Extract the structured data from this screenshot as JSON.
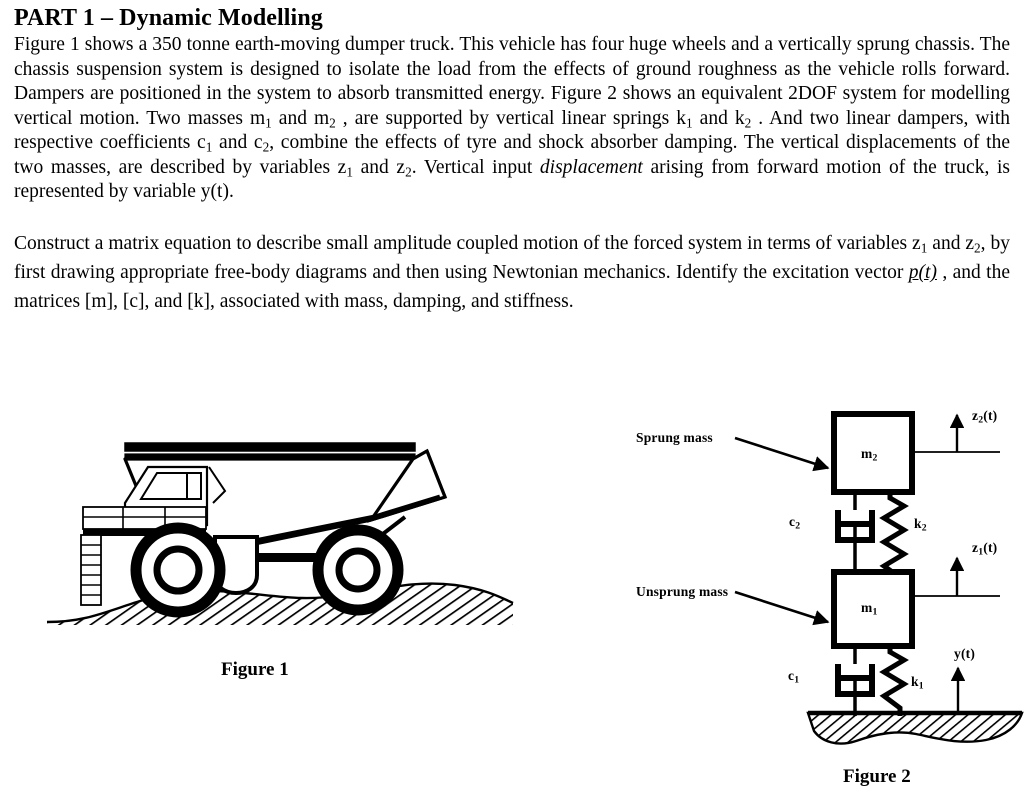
{
  "document": {
    "heading": "PART 1 –  Dynamic Modelling",
    "paragraph1": {
      "segments": [
        {
          "text": "Figure 1 shows a 350 tonne earth-moving dumper truck. This vehicle has four huge wheels and a vertically sprung chassis. The chassis suspension system is designed to isolate the load from the effects of ground roughness as the vehicle rolls forward. Dampers are positioned in the system to absorb transmitted energy. Figure 2 shows an equivalent  2DOF system for modelling vertical motion. Two masses m",
          "style": "normal"
        },
        {
          "text": "1",
          "style": "sub"
        },
        {
          "text": " and m",
          "style": "normal"
        },
        {
          "text": "2",
          "style": "sub"
        },
        {
          "text": " , are supported by vertical linear springs k",
          "style": "normal"
        },
        {
          "text": "1",
          "style": "sub"
        },
        {
          "text": " and k",
          "style": "normal"
        },
        {
          "text": "2",
          "style": "sub"
        },
        {
          "text": " . And two linear dampers, with respective coefficients c",
          "style": "normal"
        },
        {
          "text": "1",
          "style": "sub"
        },
        {
          "text": " and c",
          "style": "normal"
        },
        {
          "text": "2",
          "style": "sub"
        },
        {
          "text": ", combine the effects of tyre and shock absorber damping.  The vertical displacements of the two masses, are described by variables z",
          "style": "normal"
        },
        {
          "text": "1",
          "style": "sub"
        },
        {
          "text": " and  z",
          "style": "normal"
        },
        {
          "text": "2",
          "style": "sub"
        },
        {
          "text": ". Vertical input ",
          "style": "normal"
        },
        {
          "text": "displacement",
          "style": "italic"
        },
        {
          "text": " arising from forward motion of the truck, is represented by variable y(t).",
          "style": "normal"
        }
      ]
    },
    "paragraph2": {
      "segments": [
        {
          "text": "Construct a matrix equation to describe small amplitude coupled motion of the forced system in terms of  variables z",
          "style": "normal"
        },
        {
          "text": "1",
          "style": "sub"
        },
        {
          "text": "  and  z",
          "style": "normal"
        },
        {
          "text": "2",
          "style": "sub"
        },
        {
          "text": ",  by first drawing appropriate free-body diagrams and then using Newtonian mechanics.   Identify the excitation vector  ",
          "style": "normal"
        },
        {
          "text": "p(t)",
          "style": "underline-italic"
        },
        {
          "text": " , and the matrices [m], [c], and [k], associated with mass, damping, and stiffness.",
          "style": "normal"
        }
      ]
    }
  },
  "figure1": {
    "caption": "Figure 1",
    "description": "side view line drawing of a 350 tonne earth-moving dumper truck on uneven hatched ground"
  },
  "figure2": {
    "caption": "Figure 2",
    "labels": {
      "sprung_mass": "Sprung mass",
      "unsprung_mass": "Unsprung mass",
      "mass_upper": "m",
      "mass_upper_sub": "2",
      "mass_lower": "m",
      "mass_lower_sub": "1",
      "damper_upper": "c",
      "damper_upper_sub": "2",
      "damper_lower": "c",
      "damper_lower_sub": "1",
      "spring_upper": "k",
      "spring_upper_sub": "2",
      "spring_lower": "k",
      "spring_lower_sub": "1",
      "disp_upper": "z",
      "disp_upper_sub": "2",
      "disp_upper_arg": "(t)",
      "disp_lower": "z",
      "disp_lower_sub": "1",
      "disp_lower_arg": "(t)",
      "input_disp": "y(t)"
    }
  },
  "colors": {
    "ink": "#000000",
    "page": "#ffffff"
  }
}
